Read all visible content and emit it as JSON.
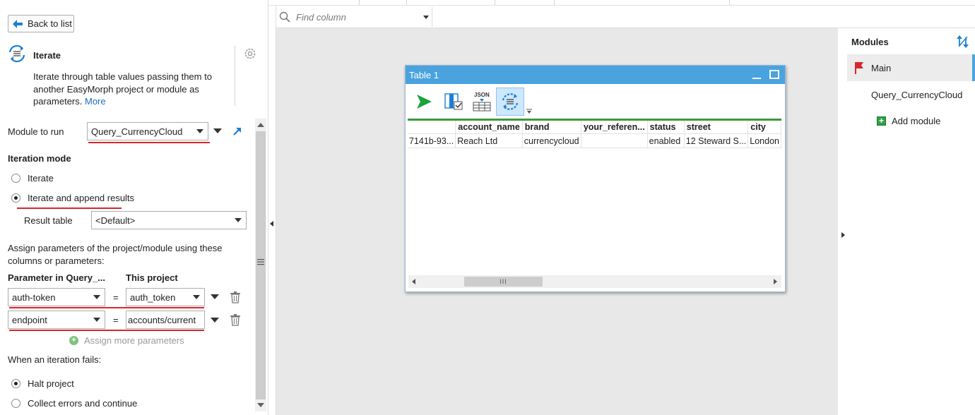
{
  "app": {
    "back_label": "Back to list"
  },
  "action": {
    "title": "Iterate",
    "description": "Iterate through table values passing them to another EasyMorph project or module as parameters.",
    "more_link": "More"
  },
  "module_to_run": {
    "label": "Module to run",
    "value": "Query_CurrencyCloud"
  },
  "iteration_mode": {
    "heading": "Iteration mode",
    "options": [
      {
        "label": "Iterate",
        "selected": false
      },
      {
        "label": "Iterate and append results",
        "selected": true
      }
    ],
    "result_table_label": "Result table",
    "result_table_value": "<Default>"
  },
  "params": {
    "intro": "Assign parameters of the project/module using these columns or parameters:",
    "col_left": "Parameter in Query_...",
    "col_right": "This project",
    "eq": "=",
    "rows": [
      {
        "param": "auth-token",
        "value": "auth_token"
      },
      {
        "param": "endpoint",
        "value": "accounts/current"
      }
    ],
    "add_more": "Assign more parameters"
  },
  "failure": {
    "heading": "When an iteration fails:",
    "options": [
      {
        "label": "Halt project",
        "selected": true
      },
      {
        "label": "Collect errors and continue",
        "selected": false
      }
    ]
  },
  "find_column": {
    "placeholder": "Find column"
  },
  "table_window": {
    "title": "Table 1",
    "json_label": "JSON",
    "columns": [
      "",
      "account_name",
      "brand",
      "your_referen...",
      "status",
      "street",
      "city"
    ],
    "rows": [
      [
        "7141b-93...",
        "Reach Ltd",
        "currencycloud",
        "",
        "enabled",
        "12 Steward S...",
        "London"
      ]
    ],
    "hscroll_thumb": "III"
  },
  "modules": {
    "title": "Modules",
    "items": [
      {
        "label": "Main",
        "active": true
      },
      {
        "label": "Query_CurrencyCloud",
        "active": false
      }
    ],
    "add_label": "Add module"
  },
  "colors": {
    "accent": "#4aa3df",
    "red_underline": "#d9262b",
    "grid_green": "#3c9a3c"
  }
}
